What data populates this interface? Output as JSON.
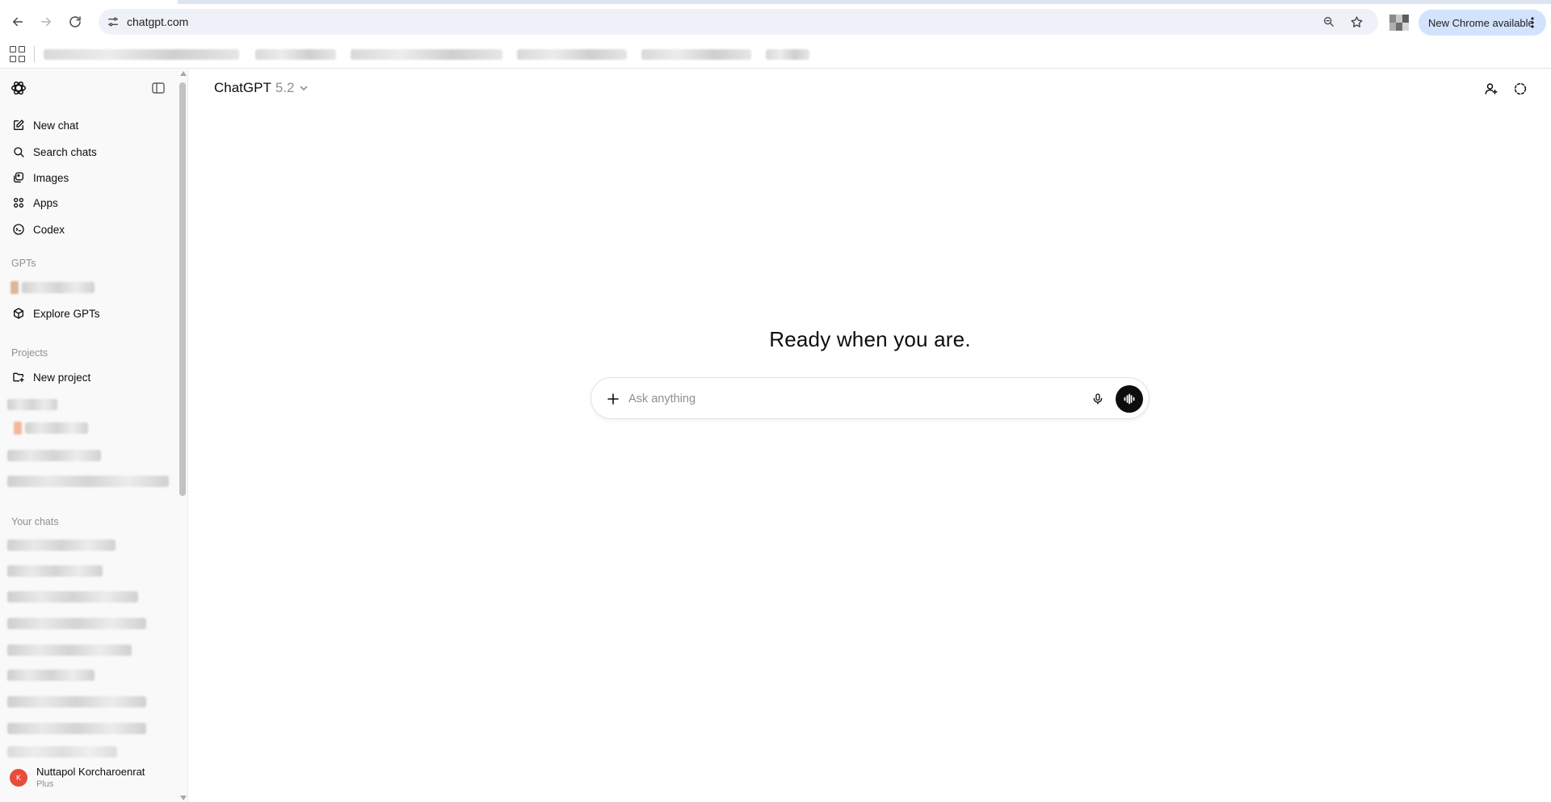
{
  "browser": {
    "url": "chatgpt.com",
    "update_chip_label": "New Chrome available",
    "icons": {
      "back": "back-arrow-icon",
      "forward": "forward-arrow-icon",
      "reload": "reload-icon",
      "site_info": "site-info-icon",
      "zoom": "zoom-icon",
      "bookmark": "star-icon",
      "menu": "kebab-menu-icon",
      "apps": "apps-grid-icon"
    }
  },
  "sidebar": {
    "nav": [
      {
        "label": "New chat",
        "icon": "new-chat-icon"
      },
      {
        "label": "Search chats",
        "icon": "search-icon"
      },
      {
        "label": "Images",
        "icon": "images-icon"
      },
      {
        "label": "Apps",
        "icon": "apps-icon"
      },
      {
        "label": "Codex",
        "icon": "codex-icon"
      }
    ],
    "gpts_label": "GPTs",
    "explore_gpts": "Explore GPTs",
    "projects_label": "Projects",
    "new_project": "New project",
    "your_chats_label": "Your chats",
    "user": {
      "initial": "K",
      "name": "Nuttapol Korcharoenrat",
      "plan": "Plus",
      "avatar_color": "#e74c3c"
    }
  },
  "main": {
    "model_name": "ChatGPT",
    "model_version": "5.2",
    "headline": "Ready when you are.",
    "composer_placeholder": "Ask anything"
  }
}
